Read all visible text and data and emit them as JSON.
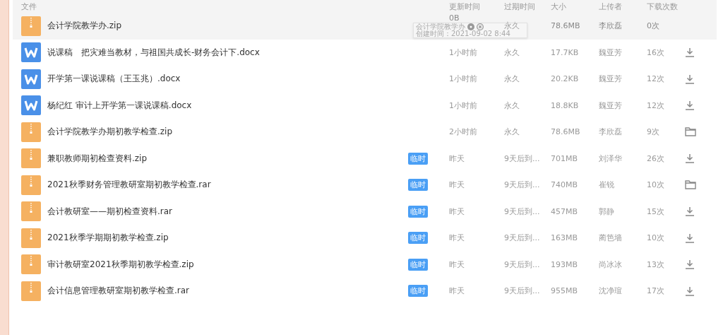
{
  "columns": [
    "文件",
    "更新时间",
    "过期时间",
    "大小",
    "上传者",
    "下载次数"
  ],
  "rows": [
    {
      "kind": "zip",
      "name": "会计学院教学办.zip",
      "temporary": false,
      "updated": "0B",
      "expires": "永久",
      "size": "78.6MB",
      "uploader": "李欣磊",
      "downloads": "0次",
      "highlighted": true
    },
    {
      "kind": "word",
      "name": "说课稿　把灾难当教材，与祖国共成长-财务会计下.docx",
      "temporary": false,
      "updated": "1小时前",
      "expires": "永久",
      "size": "17.7KB",
      "uploader": "魏亚芳",
      "downloads": "16次",
      "action": {
        "kind": "download"
      },
      "highlighted": false
    },
    {
      "kind": "word",
      "name": "开学第一课说课稿（王玉兆）.docx",
      "temporary": false,
      "updated": "1小时前",
      "expires": "永久",
      "size": "20.2KB",
      "uploader": "魏亚芳",
      "downloads": "12次",
      "action": {
        "kind": "download"
      },
      "highlighted": false
    },
    {
      "kind": "word",
      "name": "杨纪红 审计上开学第一课说课稿.docx",
      "temporary": false,
      "updated": "1小时前",
      "expires": "永久",
      "size": "18.8KB",
      "uploader": "魏亚芳",
      "downloads": "12次",
      "action": {
        "kind": "download"
      },
      "highlighted": false
    },
    {
      "kind": "zip",
      "name": "会计学院教学办期初教学检查.zip",
      "temporary": false,
      "updated": "2小时前",
      "expires": "永久",
      "size": "78.6MB",
      "uploader": "李欣磊",
      "downloads": "9次",
      "action": {
        "kind": "folder"
      },
      "highlighted": false
    },
    {
      "kind": "zip",
      "name": "兼职教师期初检查资料.zip",
      "temporary": true,
      "badge": "临时",
      "updated": "昨天",
      "expires": "9天后到...",
      "size": "701MB",
      "uploader": "刘泽华",
      "downloads": "26次",
      "action": {
        "kind": "download"
      },
      "highlighted": false
    },
    {
      "kind": "zip",
      "name": "2021秋季财务管理教研室期初教学检查.rar",
      "temporary": true,
      "badge": "临时",
      "updated": "昨天",
      "expires": "9天后到...",
      "size": "740MB",
      "uploader": "崔锐",
      "downloads": "10次",
      "action": {
        "kind": "folder"
      },
      "highlighted": false
    },
    {
      "kind": "zip",
      "name": "会计教研室——期初检查资料.rar",
      "temporary": true,
      "badge": "临时",
      "updated": "昨天",
      "expires": "9天后到...",
      "size": "457MB",
      "uploader": "郭静",
      "downloads": "15次",
      "action": {
        "kind": "download"
      },
      "highlighted": false
    },
    {
      "kind": "zip",
      "name": "2021秋季学期期初教学检查.zip",
      "temporary": true,
      "badge": "临时",
      "updated": "昨天",
      "expires": "9天后到...",
      "size": "163MB",
      "uploader": "蔺笆墙",
      "downloads": "10次",
      "action": {
        "kind": "download"
      },
      "highlighted": false
    },
    {
      "kind": "zip",
      "name": "审计教研室2021秋季期初教学检查.zip",
      "temporary": true,
      "badge": "临时",
      "updated": "昨天",
      "expires": "9天后到...",
      "size": "193MB",
      "uploader": "尚冰冰",
      "downloads": "13次",
      "action": {
        "kind": "download"
      },
      "highlighted": false
    },
    {
      "kind": "zip",
      "name": "会计信息管理教研室期初教学检查.rar",
      "temporary": true,
      "badge": "临时",
      "updated": "昨天",
      "expires": "9天后到...",
      "size": "955MB",
      "uploader": "沈净瑄",
      "downloads": "17次",
      "action": {
        "kind": "download"
      },
      "highlighted": false
    }
  ],
  "tooltip": {
    "title": "会计学院教学办",
    "created": "创建时间：2021-09-02 8:44"
  }
}
